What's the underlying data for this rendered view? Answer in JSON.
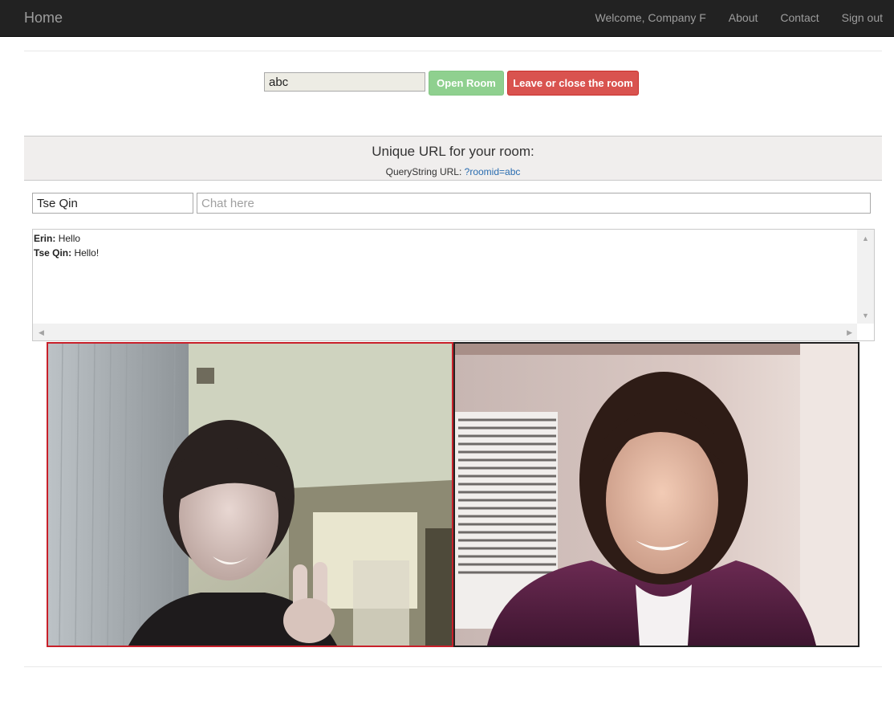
{
  "nav": {
    "brand": "Home",
    "welcome": "Welcome, Company F",
    "about": "About",
    "contact": "Contact",
    "signout": "Sign out"
  },
  "room": {
    "input_value": "abc",
    "open_label": "Open Room",
    "leave_label": "Leave or close the room"
  },
  "url_panel": {
    "title": "Unique URL for your room:",
    "label": "QueryString URL:",
    "link": "?roomid=abc"
  },
  "chat": {
    "name_value": "Tse Qin",
    "placeholder": "Chat here",
    "messages": [
      {
        "sender": "Erin:",
        "text": "Hello"
      },
      {
        "sender": "Tse Qin:",
        "text": "Hello!"
      }
    ]
  },
  "colors": {
    "navbar": "#222222",
    "open_button": "#8fd08f",
    "leave_button": "#d9534f",
    "active_video_border": "#c8202a",
    "link": "#2a6db0"
  }
}
